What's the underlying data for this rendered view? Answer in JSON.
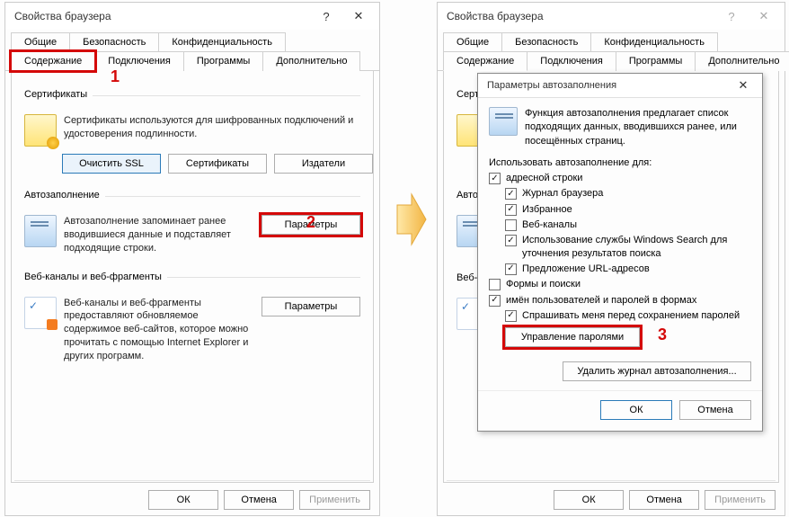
{
  "marker1": "1",
  "marker2": "2",
  "marker3": "3",
  "left": {
    "title": "Свойства браузера",
    "tabs_top": [
      "Общие",
      "Безопасность",
      "Конфиденциальность"
    ],
    "tabs_bottom": [
      "Содержание",
      "Подключения",
      "Программы",
      "Дополнительно"
    ],
    "cert": {
      "header": "Сертификаты",
      "desc": "Сертификаты используются для шифрованных подключений и удостоверения подлинности.",
      "btn_clear_ssl": "Очистить SSL",
      "btn_certs": "Сертификаты",
      "btn_publishers": "Издатели"
    },
    "auto": {
      "header": "Автозаполнение",
      "desc": "Автозаполнение запоминает ранее вводившиеся данные и подставляет подходящие строки.",
      "btn_params": "Параметры"
    },
    "feeds": {
      "header": "Веб-каналы и веб-фрагменты",
      "desc": "Веб-каналы и веб-фрагменты предоставляют обновляемое содержимое веб-сайтов, которое можно прочитать с помощью Internet Explorer и других программ.",
      "btn_params": "Параметры"
    },
    "footer": {
      "ok": "ОК",
      "cancel": "Отмена",
      "apply": "Применить"
    }
  },
  "right": {
    "title": "Свойства браузера",
    "tabs_top": [
      "Общие",
      "Безопасность",
      "Конфиденциальность"
    ],
    "tabs_bottom": [
      "Содержание",
      "Подключения",
      "Программы",
      "Дополнительно"
    ],
    "footer": {
      "ok": "ОК",
      "cancel": "Отмена",
      "apply": "Применить"
    },
    "bg_headers": {
      "cert": "Серти",
      "auto": "Автоз",
      "feeds": "Веб-к"
    }
  },
  "modal": {
    "title": "Параметры автозаполнения",
    "intro": "Функция автозаполнения предлагает список подходящих данных, вводившихся ранее, или посещённых страниц.",
    "use_for": "Использовать автозаполнение для:",
    "cb_address": "адресной строки",
    "cb_history": "Журнал браузера",
    "cb_fav": "Избранное",
    "cb_webch": "Веб-каналы",
    "cb_winsearch": "Использование службы Windows Search для уточнения результатов поиска",
    "cb_urlsuggest": "Предложение URL-адресов",
    "cb_forms": "Формы и поиски",
    "cb_userpass": "имён пользователей и паролей в формах",
    "cb_askbefore": "Спрашивать меня перед сохранением паролей",
    "btn_manage_pw": "Управление паролями",
    "btn_clear_hist": "Удалить журнал автозаполнения...",
    "footer": {
      "ok": "ОК",
      "cancel": "Отмена"
    }
  }
}
